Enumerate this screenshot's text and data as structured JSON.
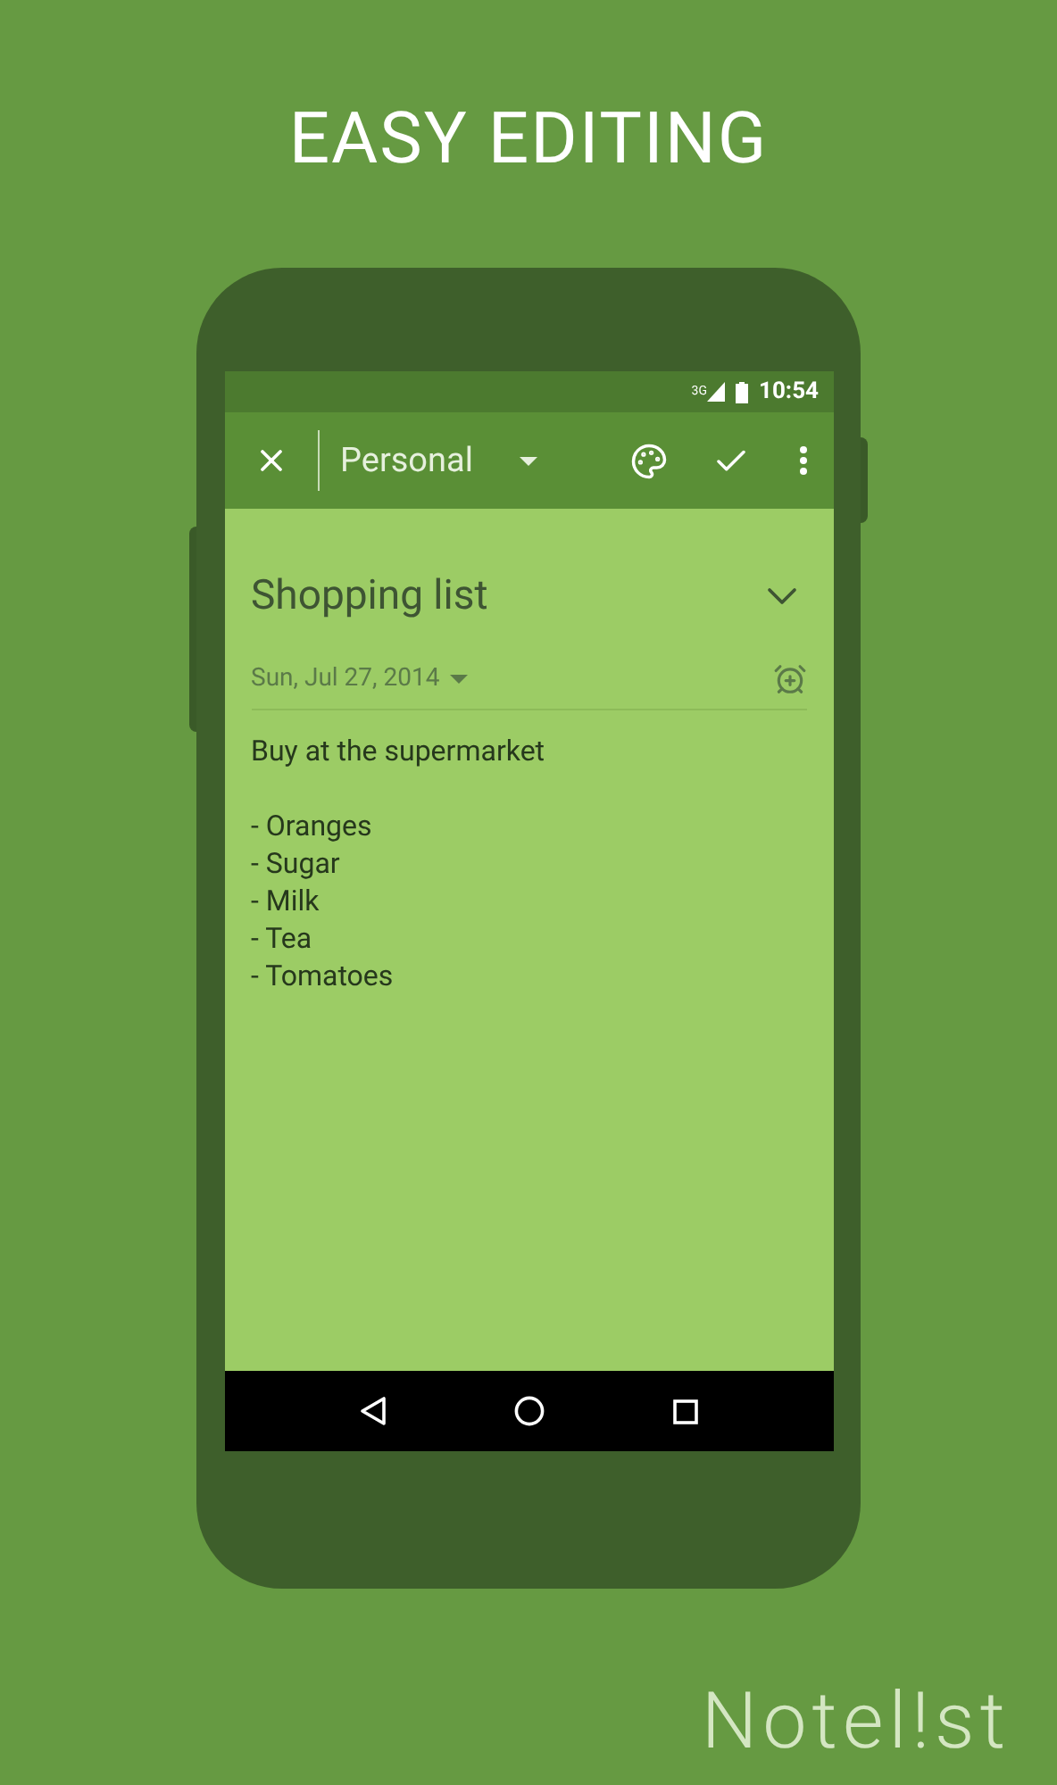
{
  "headline": "EASY EDITING",
  "status_bar": {
    "network": "3G",
    "time": "10:54"
  },
  "toolbar": {
    "category": "Personal"
  },
  "note": {
    "title": "Shopping list",
    "date": "Sun, Jul 27, 2014",
    "body": "Buy at the supermarket\n\n- Oranges\n- Sugar\n- Milk\n- Tea\n- Tomatoes"
  },
  "logo": "Notel!st"
}
